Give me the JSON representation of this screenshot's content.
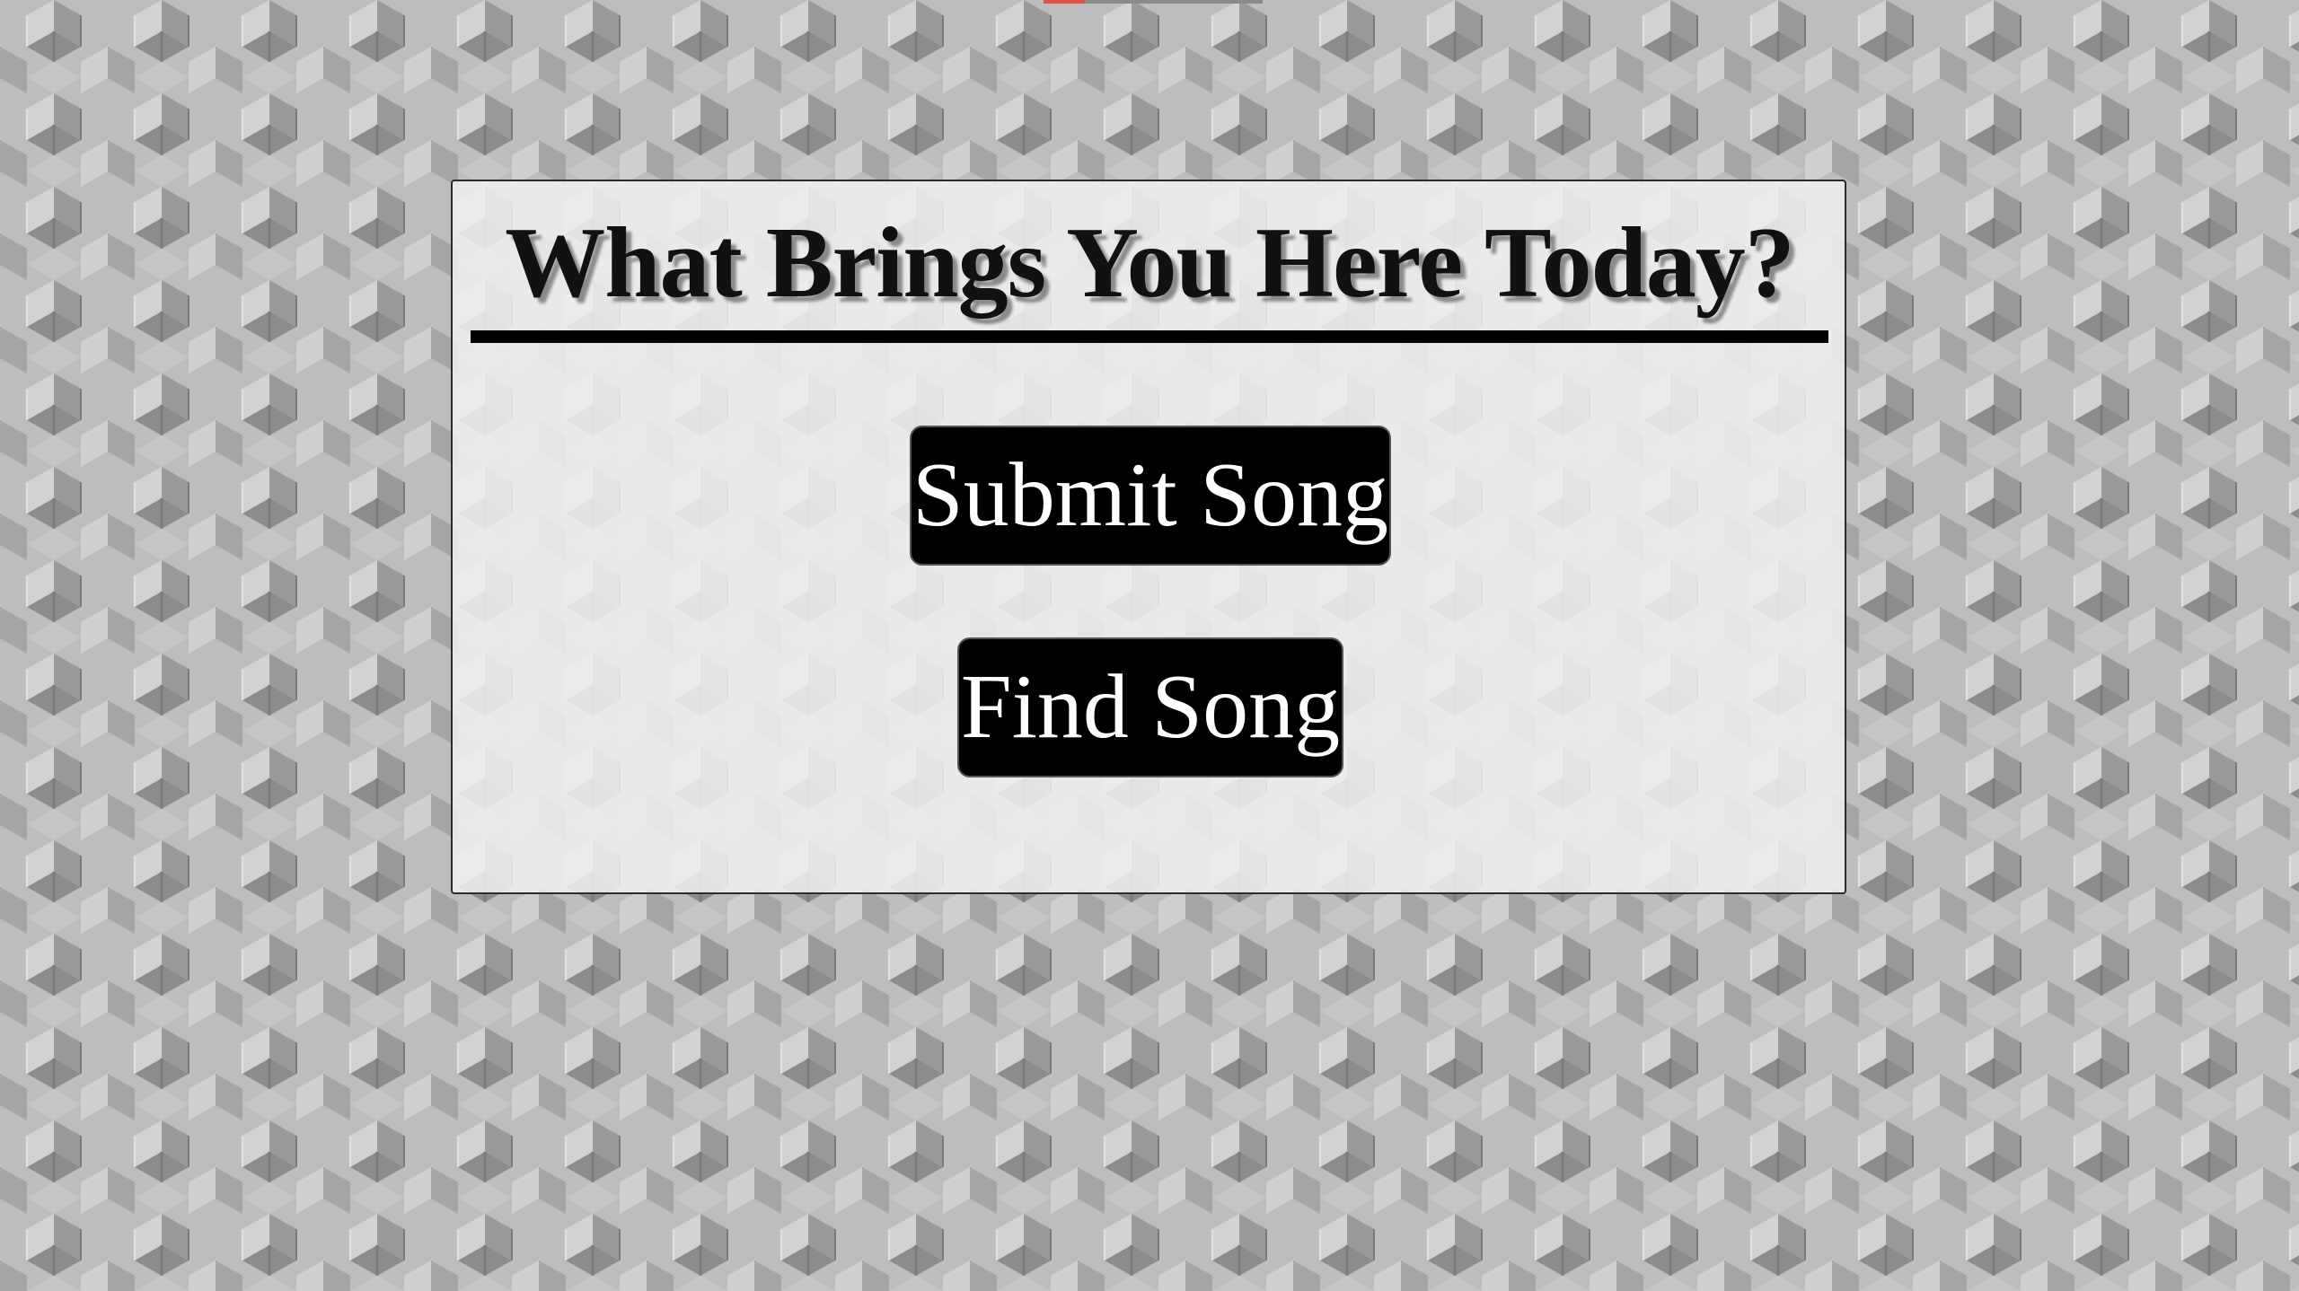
{
  "page": {
    "background_color": "#b3b3b3",
    "panel_background": "#f0f0f0",
    "accent_color": "#000000"
  },
  "prompt": {
    "title": "What Brings You Here Today?"
  },
  "actions": {
    "submit_label": "Submit Song",
    "find_label": "Find Song"
  }
}
